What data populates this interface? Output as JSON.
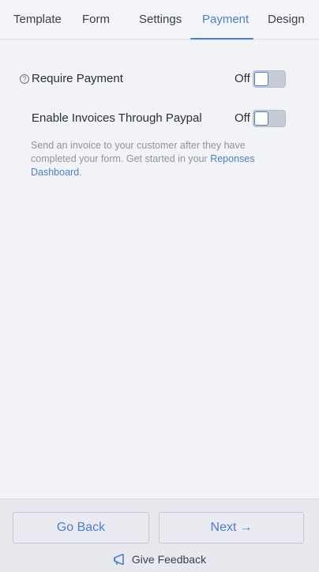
{
  "tabs": [
    {
      "label": "Template"
    },
    {
      "label": "Form"
    },
    {
      "label": "Settings"
    },
    {
      "label": "Payment"
    },
    {
      "label": "Design"
    }
  ],
  "active_tab": "Payment",
  "settings": {
    "require_payment": {
      "help_icon": "?",
      "label": "Require Payment",
      "state_text": "Off",
      "on": false
    },
    "enable_invoices": {
      "label": "Enable Invoices Through Paypal",
      "state_text": "Off",
      "on": false
    },
    "description_text": "Send an invoice to your customer after they have completed your form. Get started in your ",
    "description_link": "Reponses Dashboard",
    "description_end": "."
  },
  "footer": {
    "back_label": "Go Back",
    "next_label": "Next",
    "next_arrow": "→",
    "feedback_label": "Give Feedback"
  },
  "colors": {
    "accent": "#4a7fd6",
    "background": "#f2f3f7",
    "muted_text": "#8e93a1"
  }
}
